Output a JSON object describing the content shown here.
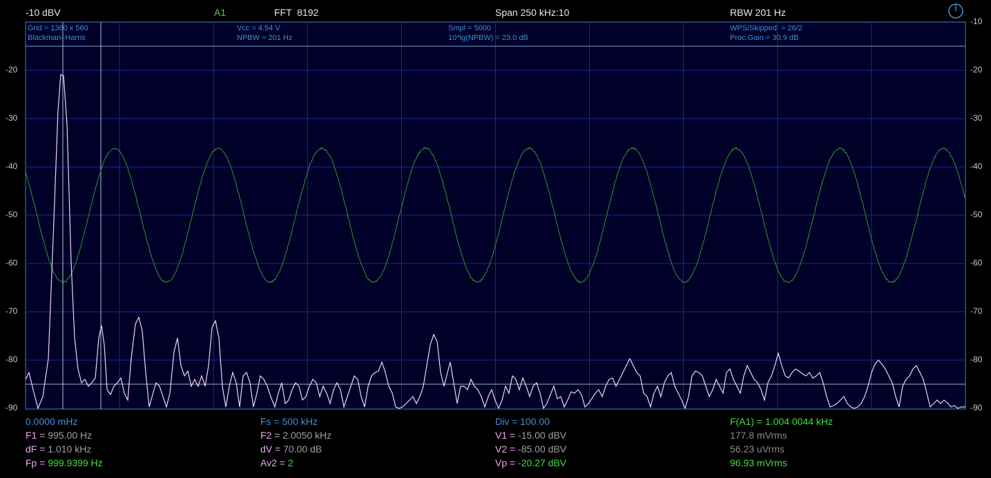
{
  "header": {
    "ref_level": "-10 dBV",
    "channel": "A1",
    "fft": "FFT  8192",
    "span": "Span 250 kHz:10",
    "rbw": "RBW 201 Hz"
  },
  "info": {
    "grid": "Grid = 1360 x 560",
    "window": "Blackman–Harris",
    "vcc": "Vcc = 4.54 V",
    "npbw": "NPBW = 201 Hz",
    "smpl": "Smpl = 5000",
    "lg_npbw": "10*lg(NPBW) = 23.0 dB",
    "wps": "WPS/Skipped  = 26/2",
    "proc_gain": "Proc.Gain = 30.9 dB"
  },
  "axis": {
    "left": [
      "-20",
      "-30",
      "-40",
      "-50",
      "-60",
      "-70",
      "-80",
      "-90"
    ],
    "right": [
      "-10",
      "-20",
      "-30",
      "-40",
      "-50",
      "-60",
      "-70",
      "-80",
      "-90"
    ]
  },
  "readouts": {
    "col1": {
      "start": "0.0000 mHz",
      "f1_label": "F1 = ",
      "f1_value": "995.00 Hz",
      "df_label": "dF = ",
      "df_value": "1.010 kHz",
      "fp_label": "Fp = ",
      "fp_value": "999.9399 Hz"
    },
    "col2": {
      "fs": "Fs = 500 kHz",
      "f2_label": "F2 = ",
      "f2_value": "2.0050 kHz",
      "dv_label": "dV = ",
      "dv_value": "70.00 dB",
      "av2_label": "Av2 = ",
      "av2_value": "2"
    },
    "col3": {
      "div": "Div = 100.00",
      "v1_label": "V1 = ",
      "v1_value": "-15.00 dBV",
      "v2_label": "V2 = ",
      "v2_value": "-85.00 dBV",
      "vp_label": "Vp = ",
      "vp_value": "-20.27 dBV"
    },
    "col4": {
      "fa1": "F(A1) = 1.004 0044 kHz",
      "mv1": "177.8 mVrms",
      "uv": "56.23 uVrms",
      "mv2": "96.93 mVrms"
    }
  },
  "colors": {
    "grid": "#1c2a9e",
    "spectrum": "#f3d6f5",
    "waveform": "#2a9a2a",
    "frame": "#3f7fd0"
  },
  "icons": {
    "power": "power-icon"
  }
}
